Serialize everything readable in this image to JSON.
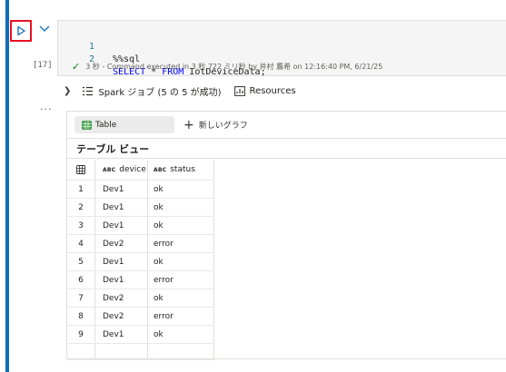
{
  "cell": {
    "execution_count": "[17]",
    "code_lines": [
      {
        "num": "1",
        "text": "%%sql"
      },
      {
        "num": "2",
        "kw1": "SELECT",
        "star": " * ",
        "kw2": "FROM",
        "rest": " IotDeviceData;"
      }
    ],
    "status": "3 秒 - Command executed in 3 秒 722 ミリ秒 by 井村 鷹希 on 12:16:40 PM, 6/21/25"
  },
  "jobs": {
    "spark_label": "Spark ジョブ (5 の 5 が成功)",
    "resources_label": "Resources"
  },
  "output": {
    "tabs": {
      "table": "Table",
      "new_graph": "新しいグラフ"
    },
    "view_title": "テーブル ビュー",
    "columns": [
      {
        "type": "ABC",
        "name": "device"
      },
      {
        "type": "ABC",
        "name": "status"
      }
    ],
    "rows": [
      [
        "1",
        "Dev1",
        "ok"
      ],
      [
        "2",
        "Dev1",
        "ok"
      ],
      [
        "3",
        "Dev1",
        "ok"
      ],
      [
        "4",
        "Dev2",
        "error"
      ],
      [
        "5",
        "Dev1",
        "ok"
      ],
      [
        "6",
        "Dev1",
        "error"
      ],
      [
        "7",
        "Dev2",
        "ok"
      ],
      [
        "8",
        "Dev2",
        "error"
      ],
      [
        "9",
        "Dev1",
        "ok"
      ]
    ]
  },
  "colors": {
    "accent": "#0f6cbd",
    "run_highlight": "#e81123",
    "success": "#107c10",
    "keyword": "#0000ff"
  },
  "icons": {
    "run": "play-icon",
    "collapse": "chevron-down-icon",
    "expand": "chevron-right-icon",
    "success": "checkmark-icon",
    "spark": "spark-jobs-icon",
    "resources": "resources-icon",
    "table": "table-icon",
    "add": "plus-icon",
    "grid_corner": "table-grid-icon"
  }
}
